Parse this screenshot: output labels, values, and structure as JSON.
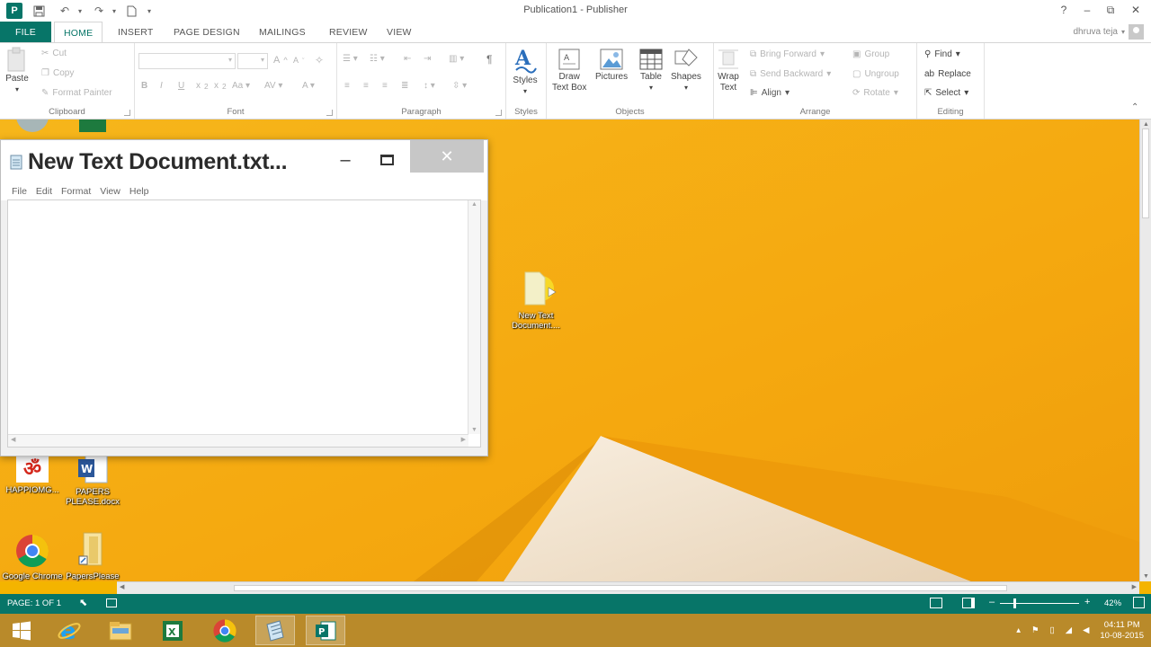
{
  "titlebar": {
    "app_title": "Publication1 - Publisher",
    "logo_letter": "P",
    "help": "?",
    "minimize": "–",
    "restore": "⧉",
    "close": "✕"
  },
  "tabs": {
    "file": "FILE",
    "home": "HOME",
    "insert": "INSERT",
    "page_design": "PAGE DESIGN",
    "mailings": "MAILINGS",
    "review": "REVIEW",
    "view": "VIEW"
  },
  "user": {
    "name": "dhruva teja"
  },
  "ribbon": {
    "clipboard": {
      "label": "Clipboard",
      "paste": "Paste",
      "cut": "Cut",
      "copy": "Copy",
      "format_painter": "Format Painter"
    },
    "font": {
      "label": "Font"
    },
    "paragraph": {
      "label": "Paragraph",
      "pilcrow": "¶"
    },
    "styles": {
      "label": "Styles",
      "styles_button": "Styles"
    },
    "objects": {
      "label": "Objects",
      "draw_text_box_1": "Draw",
      "draw_text_box_2": "Text Box",
      "pictures": "Pictures",
      "table": "Table",
      "shapes": "Shapes"
    },
    "arrange": {
      "label": "Arrange",
      "wrap_text_1": "Wrap",
      "wrap_text_2": "Text",
      "bring_forward": "Bring Forward",
      "send_backward": "Send Backward",
      "align": "Align",
      "group": "Group",
      "ungroup": "Ungroup",
      "rotate": "Rotate"
    },
    "editing": {
      "label": "Editing",
      "find": "Find",
      "replace": "Replace",
      "select": "Select"
    }
  },
  "notepad": {
    "title": "New Text Document.txt...",
    "menu": [
      "File",
      "Edit",
      "Format",
      "View",
      "Help"
    ]
  },
  "desktop_icons": {
    "new_text_doc": "New Text Document....",
    "om": "HAPPIOMG...",
    "word_doc": "PAPERS PLEASE.docx",
    "chrome": "Google Chrome",
    "paperplease": "PapersPlease Shortcut"
  },
  "statusbar": {
    "page": "PAGE: 1 OF 1",
    "zoom": "42%"
  },
  "taskbar": {
    "time": "04:11 PM",
    "date": "10-08-2015"
  },
  "colors": {
    "publisher_teal": "#077568",
    "desktop_orange": "#f5ab12",
    "taskbar": "#b98a2a"
  }
}
